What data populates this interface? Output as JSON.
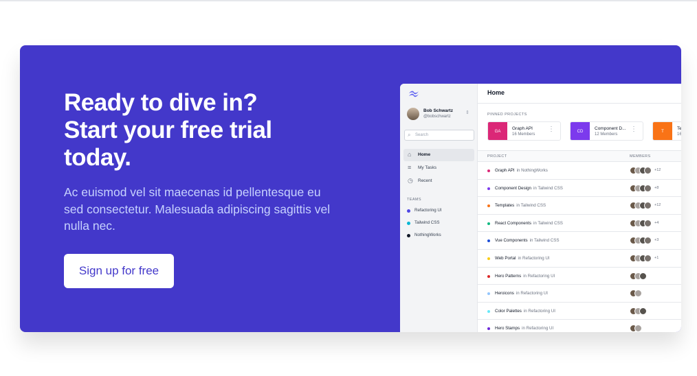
{
  "hero": {
    "headline_lines": [
      "Ready to dive in?",
      "Start your free trial",
      "today."
    ],
    "description": "Ac euismod vel sit maecenas id pellentesque eu sed consectetur. Malesuada adipiscing sagittis vel nulla nec.",
    "cta_label": "Sign up for free"
  },
  "colors": {
    "banner_bg": "#4338ca",
    "accent_text": "#c7d2fe"
  },
  "app": {
    "user": {
      "name": "Bob Schwartz",
      "handle": "@bobschwartz"
    },
    "search_placeholder": "Search",
    "nav": [
      {
        "label": "Home",
        "icon": "home-icon",
        "active": true
      },
      {
        "label": "My Tasks",
        "icon": "list-icon",
        "active": false
      },
      {
        "label": "Recent",
        "icon": "clock-icon",
        "active": false
      }
    ],
    "teams_heading": "TEAMS",
    "teams": [
      {
        "label": "Refactoring UI",
        "color": "#4f46e5"
      },
      {
        "label": "Tailwind CSS",
        "color": "#06b6d4"
      },
      {
        "label": "NothingWorks",
        "color": "#111827"
      }
    ],
    "title": "Home",
    "pinned_heading": "PINNED PROJECTS",
    "pinned": [
      {
        "initials": "GA",
        "name": "Graph API",
        "members": "16 Members",
        "color": "#db2777"
      },
      {
        "initials": "CD",
        "name": "Component D...",
        "members": "12 Members",
        "color": "#7c3aed"
      },
      {
        "initials": "T",
        "name": "Te",
        "members": "16",
        "color": "#f97316"
      }
    ],
    "table_headers": {
      "project": "PROJECT",
      "members": "MEMBERS"
    },
    "projects": [
      {
        "name": "Graph API",
        "team": "in NothingWorks",
        "dot": "#db2777",
        "avatars": 4,
        "extra": "+12"
      },
      {
        "name": "Component Design",
        "team": "in Tailwind CSS",
        "dot": "#7c3aed",
        "avatars": 4,
        "extra": "+8"
      },
      {
        "name": "Templates",
        "team": "in Tailwind CSS",
        "dot": "#f97316",
        "avatars": 4,
        "extra": "+12"
      },
      {
        "name": "React Components",
        "team": "in Tailwind CSS",
        "dot": "#10b981",
        "avatars": 4,
        "extra": "+4"
      },
      {
        "name": "Vue Components",
        "team": "in Tailwind CSS",
        "dot": "#1d4ed8",
        "avatars": 4,
        "extra": "+3"
      },
      {
        "name": "Web Portal",
        "team": "in Refactoring UI",
        "dot": "#facc15",
        "avatars": 4,
        "extra": "+1"
      },
      {
        "name": "Hero Patterns",
        "team": "in Refactoring UI",
        "dot": "#dc2626",
        "avatars": 3,
        "extra": ""
      },
      {
        "name": "Heroicons",
        "team": "in Refactoring UI",
        "dot": "#93c5fd",
        "avatars": 2,
        "extra": ""
      },
      {
        "name": "Color Palettes",
        "team": "in Refactoring UI",
        "dot": "#67e8f9",
        "avatars": 3,
        "extra": ""
      },
      {
        "name": "Hero Stamps",
        "team": "in Refactoring UI",
        "dot": "#6d28d9",
        "avatars": 2,
        "extra": ""
      }
    ]
  }
}
